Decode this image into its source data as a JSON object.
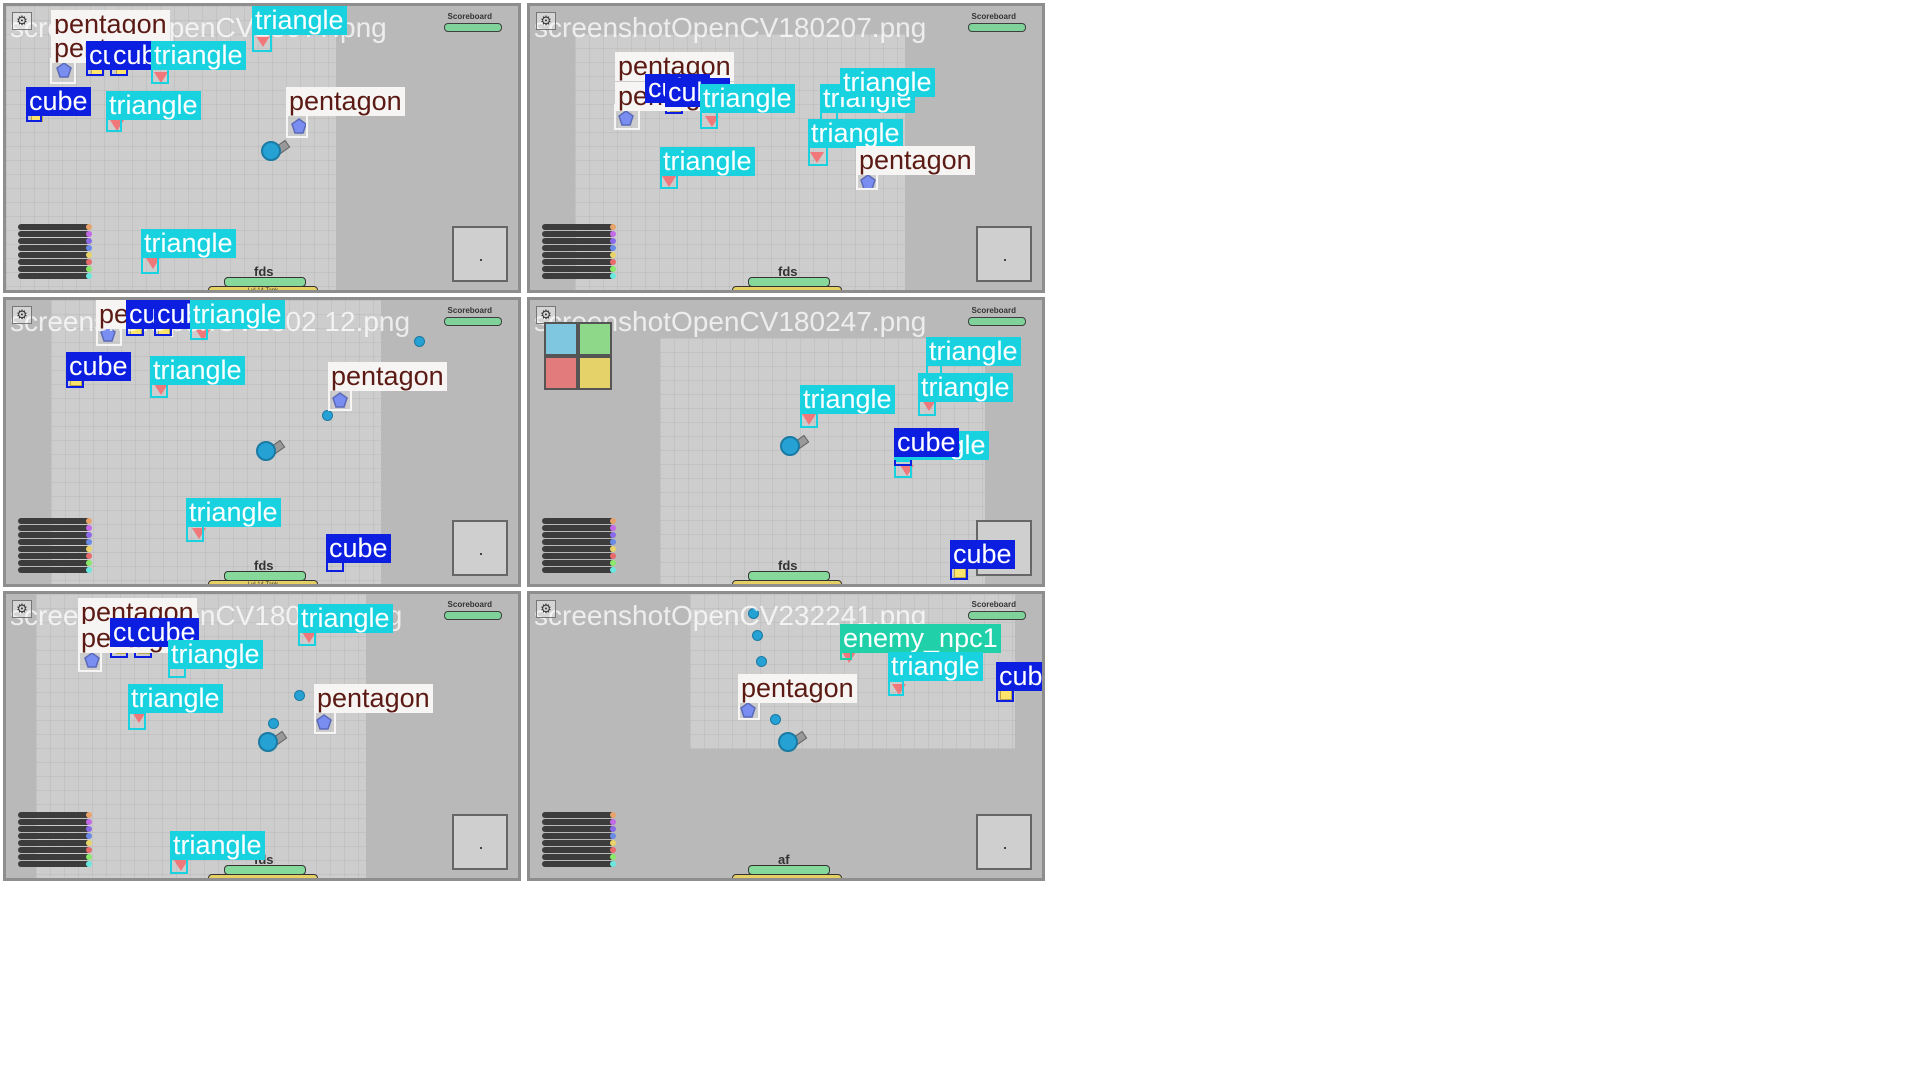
{
  "panels": [
    {
      "watermark": "screenshotOpenCV180??.png",
      "scoreboard": "Scoreboard",
      "player_name": "fds",
      "level_text": "Lvl 14 Tank",
      "detections": [
        {
          "cls": "pentagon",
          "label": "pentagon"
        },
        {
          "cls": "pentagon",
          "label": "pentagon"
        },
        {
          "cls": "cube",
          "label": "cube"
        },
        {
          "cls": "cube",
          "label": "cube"
        },
        {
          "cls": "triangle",
          "label": "triangle"
        },
        {
          "cls": "triangle",
          "label": "triangle"
        },
        {
          "cls": "cube",
          "label": "cube"
        },
        {
          "cls": "triangle",
          "label": "triangle"
        },
        {
          "cls": "pentagon",
          "label": "pentagon"
        },
        {
          "cls": "triangle",
          "label": "triangle"
        }
      ]
    },
    {
      "watermark": "screenshotOpenCV180207.png",
      "scoreboard": "Scoreboard",
      "player_name": "fds",
      "level_text": "",
      "detections": [
        {
          "cls": "pentagon",
          "label": "pentagon"
        },
        {
          "cls": "pentagon",
          "label": "pentagon"
        },
        {
          "cls": "cube",
          "label": "cube"
        },
        {
          "cls": "cube",
          "label": "cube"
        },
        {
          "cls": "triangle",
          "label": "triangle"
        },
        {
          "cls": "triangle",
          "label": "triangle"
        },
        {
          "cls": "triangle",
          "label": "triangle"
        },
        {
          "cls": "triangle",
          "label": "triangle"
        },
        {
          "cls": "triangle",
          "label": "triangle"
        },
        {
          "cls": "pentagon",
          "label": "pentagon"
        }
      ]
    },
    {
      "watermark": "screenshotOpenCV1802 12.png",
      "scoreboard": "Scoreboard",
      "player_name": "fds",
      "level_text": "Lvl 14 Tank",
      "detections": [
        {
          "cls": "pentagon",
          "label": "pentagon"
        },
        {
          "cls": "pentagon",
          "label": "pentagon"
        },
        {
          "cls": "cube",
          "label": "cube"
        },
        {
          "cls": "cube",
          "label": "cube"
        },
        {
          "cls": "triangle",
          "label": "triangle"
        },
        {
          "cls": "cube",
          "label": "cube"
        },
        {
          "cls": "triangle",
          "label": "triangle"
        },
        {
          "cls": "pentagon",
          "label": "pentagon"
        },
        {
          "cls": "triangle",
          "label": "triangle"
        },
        {
          "cls": "cube",
          "label": "cube"
        }
      ]
    },
    {
      "watermark": "screenshotOpenCV180247.png",
      "scoreboard": "Scoreboard",
      "player_name": "fds",
      "level_text": "",
      "detections": [
        {
          "cls": "triangle",
          "label": "triangle"
        },
        {
          "cls": "triangle",
          "label": "triangle"
        },
        {
          "cls": "triangle",
          "label": "triangle"
        },
        {
          "cls": "triangle",
          "label": "triangle"
        },
        {
          "cls": "cube",
          "label": "cube"
        },
        {
          "cls": "cube",
          "label": "cube"
        }
      ]
    },
    {
      "watermark": "screenshotOpenCV18020?.png",
      "scoreboard": "Scoreboard",
      "player_name": "fds",
      "level_text": "",
      "detections": [
        {
          "cls": "pentagon",
          "label": "pentagon"
        },
        {
          "cls": "pentagon",
          "label": "pentagon"
        },
        {
          "cls": "cube",
          "label": "cube"
        },
        {
          "cls": "cube",
          "label": "cube"
        },
        {
          "cls": "triangle",
          "label": "triangle"
        },
        {
          "cls": "triangle",
          "label": "triangle"
        },
        {
          "cls": "triangle",
          "label": "triangle"
        },
        {
          "cls": "pentagon",
          "label": "pentagon"
        },
        {
          "cls": "triangle",
          "label": "triangle"
        }
      ]
    },
    {
      "watermark": "screenshotOpenCV232241.png",
      "scoreboard": "Scoreboard",
      "player_name": "af",
      "level_text": "",
      "detections": [
        {
          "cls": "enemy_npc1",
          "label": "enemy_npc1"
        },
        {
          "cls": "triangle",
          "label": "triangle"
        },
        {
          "cls": "cube",
          "label": "cube"
        },
        {
          "cls": "pentagon",
          "label": "pentagon"
        }
      ]
    }
  ],
  "colors": {
    "pentagon_label_bg": "#f7f5f4",
    "pentagon_label_text": "#5b1a14",
    "cube_label_bg": "#0c1fe0",
    "triangle_label_bg": "#19d2e0",
    "enemy_npc1_label_bg": "#20d0a9",
    "player_body": "#26a1d3",
    "arena": "#cdcdcd"
  }
}
